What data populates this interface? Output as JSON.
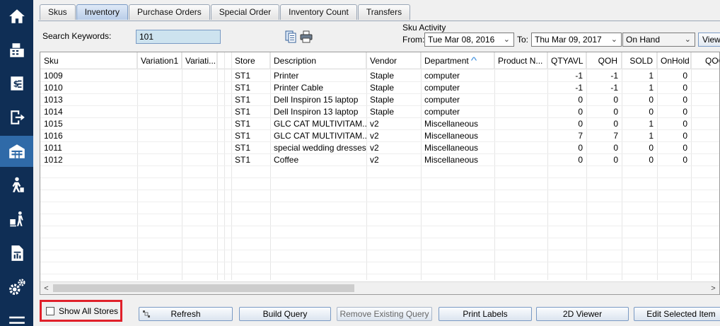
{
  "sidebar": {
    "items": [
      {
        "icon": "home-icon",
        "active": false
      },
      {
        "icon": "register-icon",
        "active": false
      },
      {
        "icon": "receipt-icon",
        "active": false
      },
      {
        "icon": "sign-out-icon",
        "active": false
      },
      {
        "icon": "inventory-icon",
        "active": true
      },
      {
        "icon": "customer-icon",
        "active": false
      },
      {
        "icon": "receiving-icon",
        "active": false
      },
      {
        "icon": "reports-icon",
        "active": false
      },
      {
        "icon": "settings-icon",
        "active": false
      },
      {
        "icon": "menu-icon",
        "active": false
      }
    ]
  },
  "tabs": [
    {
      "label": "Skus",
      "active": false
    },
    {
      "label": "Inventory",
      "active": true
    },
    {
      "label": "Purchase Orders",
      "active": false
    },
    {
      "label": "Special Order",
      "active": false
    },
    {
      "label": "Inventory Count",
      "active": false
    },
    {
      "label": "Transfers",
      "active": false
    }
  ],
  "search": {
    "label": "Search Keywords:",
    "value": "101"
  },
  "activity": {
    "title": "Sku Activity",
    "from_label": "From:",
    "from_value": "Tue  Mar 08, 2016",
    "to_label": "To:",
    "to_value": "Thu  Mar 09, 2017",
    "mode_value": "On Hand",
    "view_label": "View"
  },
  "grid": {
    "columns": [
      "Sku",
      "Variation1",
      "Variati...",
      "",
      "Store",
      "Description",
      "Vendor",
      "Department",
      "Product N...",
      "QTYAVL",
      "QOH",
      "SOLD",
      "OnHold",
      "QOO"
    ],
    "rows": [
      [
        "1009",
        "",
        "",
        "",
        "ST1",
        "Printer",
        "Staple",
        "computer",
        "",
        "-1",
        "-1",
        "1",
        "0"
      ],
      [
        "1010",
        "",
        "",
        "",
        "ST1",
        "Printer Cable",
        "Staple",
        "computer",
        "",
        "-1",
        "-1",
        "1",
        "0"
      ],
      [
        "1013",
        "",
        "",
        "",
        "ST1",
        "Dell Inspiron 15 laptop",
        "Staple",
        "computer",
        "",
        "0",
        "0",
        "0",
        "0"
      ],
      [
        "1014",
        "",
        "",
        "",
        "ST1",
        "Dell Inspiron 13 laptop",
        "Staple",
        "computer",
        "",
        "0",
        "0",
        "0",
        "0"
      ],
      [
        "1015",
        "",
        "",
        "",
        "ST1",
        "GLC CAT MULTIVITAM...",
        "v2",
        "Miscellaneous",
        "",
        "0",
        "0",
        "1",
        "0"
      ],
      [
        "1016",
        "",
        "",
        "",
        "ST1",
        "GLC CAT MULTIVITAM...",
        "v2",
        "Miscellaneous",
        "",
        "7",
        "7",
        "1",
        "0"
      ],
      [
        "1011",
        "",
        "",
        "",
        "ST1",
        "special wedding dresses",
        "v2",
        "Miscellaneous",
        "",
        "0",
        "0",
        "0",
        "0"
      ],
      [
        "1012",
        "",
        "",
        "",
        "ST1",
        "Coffee",
        "v2",
        "Miscellaneous",
        "",
        "0",
        "0",
        "0",
        "0"
      ]
    ]
  },
  "bottom": {
    "show_all_label": "Show All Stores",
    "refresh": "Refresh",
    "build_query": "Build Query",
    "remove_query": "Remove Existing Query",
    "print_labels": "Print Labels",
    "viewer_2d": "2D Viewer",
    "edit_item": "Edit Selected Item"
  },
  "colors": {
    "sidebar_bg": "#0f2e55",
    "sidebar_active": "#2f6aa8",
    "highlight_border": "#e0202a",
    "sort_arrow": "#3b8ede"
  }
}
